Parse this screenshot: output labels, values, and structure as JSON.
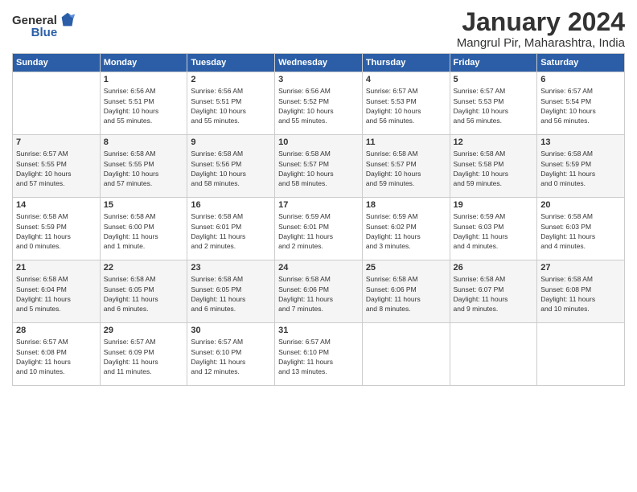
{
  "app": {
    "logo_general": "General",
    "logo_blue": "Blue"
  },
  "header": {
    "title": "January 2024",
    "location": "Mangrul Pir, Maharashtra, India"
  },
  "days_of_week": [
    "Sunday",
    "Monday",
    "Tuesday",
    "Wednesday",
    "Thursday",
    "Friday",
    "Saturday"
  ],
  "weeks": [
    [
      {
        "day": "",
        "content": ""
      },
      {
        "day": "1",
        "content": "Sunrise: 6:56 AM\nSunset: 5:51 PM\nDaylight: 10 hours\nand 55 minutes."
      },
      {
        "day": "2",
        "content": "Sunrise: 6:56 AM\nSunset: 5:51 PM\nDaylight: 10 hours\nand 55 minutes."
      },
      {
        "day": "3",
        "content": "Sunrise: 6:56 AM\nSunset: 5:52 PM\nDaylight: 10 hours\nand 55 minutes."
      },
      {
        "day": "4",
        "content": "Sunrise: 6:57 AM\nSunset: 5:53 PM\nDaylight: 10 hours\nand 56 minutes."
      },
      {
        "day": "5",
        "content": "Sunrise: 6:57 AM\nSunset: 5:53 PM\nDaylight: 10 hours\nand 56 minutes."
      },
      {
        "day": "6",
        "content": "Sunrise: 6:57 AM\nSunset: 5:54 PM\nDaylight: 10 hours\nand 56 minutes."
      }
    ],
    [
      {
        "day": "7",
        "content": "Sunrise: 6:57 AM\nSunset: 5:55 PM\nDaylight: 10 hours\nand 57 minutes."
      },
      {
        "day": "8",
        "content": "Sunrise: 6:58 AM\nSunset: 5:55 PM\nDaylight: 10 hours\nand 57 minutes."
      },
      {
        "day": "9",
        "content": "Sunrise: 6:58 AM\nSunset: 5:56 PM\nDaylight: 10 hours\nand 58 minutes."
      },
      {
        "day": "10",
        "content": "Sunrise: 6:58 AM\nSunset: 5:57 PM\nDaylight: 10 hours\nand 58 minutes."
      },
      {
        "day": "11",
        "content": "Sunrise: 6:58 AM\nSunset: 5:57 PM\nDaylight: 10 hours\nand 59 minutes."
      },
      {
        "day": "12",
        "content": "Sunrise: 6:58 AM\nSunset: 5:58 PM\nDaylight: 10 hours\nand 59 minutes."
      },
      {
        "day": "13",
        "content": "Sunrise: 6:58 AM\nSunset: 5:59 PM\nDaylight: 11 hours\nand 0 minutes."
      }
    ],
    [
      {
        "day": "14",
        "content": "Sunrise: 6:58 AM\nSunset: 5:59 PM\nDaylight: 11 hours\nand 0 minutes."
      },
      {
        "day": "15",
        "content": "Sunrise: 6:58 AM\nSunset: 6:00 PM\nDaylight: 11 hours\nand 1 minute."
      },
      {
        "day": "16",
        "content": "Sunrise: 6:58 AM\nSunset: 6:01 PM\nDaylight: 11 hours\nand 2 minutes."
      },
      {
        "day": "17",
        "content": "Sunrise: 6:59 AM\nSunset: 6:01 PM\nDaylight: 11 hours\nand 2 minutes."
      },
      {
        "day": "18",
        "content": "Sunrise: 6:59 AM\nSunset: 6:02 PM\nDaylight: 11 hours\nand 3 minutes."
      },
      {
        "day": "19",
        "content": "Sunrise: 6:59 AM\nSunset: 6:03 PM\nDaylight: 11 hours\nand 4 minutes."
      },
      {
        "day": "20",
        "content": "Sunrise: 6:58 AM\nSunset: 6:03 PM\nDaylight: 11 hours\nand 4 minutes."
      }
    ],
    [
      {
        "day": "21",
        "content": "Sunrise: 6:58 AM\nSunset: 6:04 PM\nDaylight: 11 hours\nand 5 minutes."
      },
      {
        "day": "22",
        "content": "Sunrise: 6:58 AM\nSunset: 6:05 PM\nDaylight: 11 hours\nand 6 minutes."
      },
      {
        "day": "23",
        "content": "Sunrise: 6:58 AM\nSunset: 6:05 PM\nDaylight: 11 hours\nand 6 minutes."
      },
      {
        "day": "24",
        "content": "Sunrise: 6:58 AM\nSunset: 6:06 PM\nDaylight: 11 hours\nand 7 minutes."
      },
      {
        "day": "25",
        "content": "Sunrise: 6:58 AM\nSunset: 6:06 PM\nDaylight: 11 hours\nand 8 minutes."
      },
      {
        "day": "26",
        "content": "Sunrise: 6:58 AM\nSunset: 6:07 PM\nDaylight: 11 hours\nand 9 minutes."
      },
      {
        "day": "27",
        "content": "Sunrise: 6:58 AM\nSunset: 6:08 PM\nDaylight: 11 hours\nand 10 minutes."
      }
    ],
    [
      {
        "day": "28",
        "content": "Sunrise: 6:57 AM\nSunset: 6:08 PM\nDaylight: 11 hours\nand 10 minutes."
      },
      {
        "day": "29",
        "content": "Sunrise: 6:57 AM\nSunset: 6:09 PM\nDaylight: 11 hours\nand 11 minutes."
      },
      {
        "day": "30",
        "content": "Sunrise: 6:57 AM\nSunset: 6:10 PM\nDaylight: 11 hours\nand 12 minutes."
      },
      {
        "day": "31",
        "content": "Sunrise: 6:57 AM\nSunset: 6:10 PM\nDaylight: 11 hours\nand 13 minutes."
      },
      {
        "day": "",
        "content": ""
      },
      {
        "day": "",
        "content": ""
      },
      {
        "day": "",
        "content": ""
      }
    ]
  ]
}
